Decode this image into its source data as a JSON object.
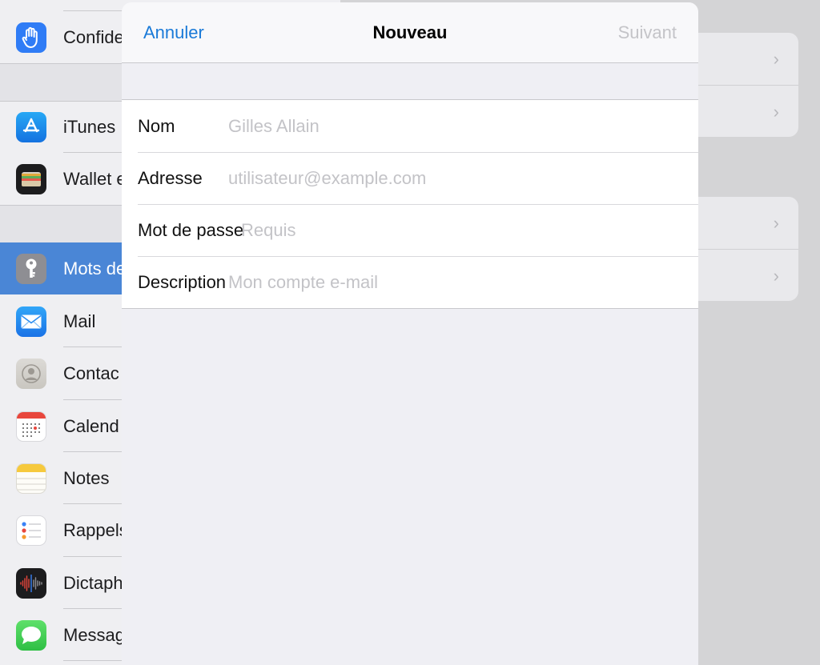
{
  "sidebar": {
    "items": [
      {
        "label": "Confide",
        "icon": "hand-icon"
      },
      {
        "label": "iTunes",
        "icon": "app-store-icon"
      },
      {
        "label": "Wallet e",
        "icon": "wallet-icon"
      },
      {
        "label": "Mots de",
        "icon": "key-icon",
        "selected": true
      },
      {
        "label": "Mail",
        "icon": "mail-icon"
      },
      {
        "label": "Contac",
        "icon": "contacts-icon"
      },
      {
        "label": "Calend",
        "icon": "calendar-icon"
      },
      {
        "label": "Notes",
        "icon": "notes-icon"
      },
      {
        "label": "Rappels",
        "icon": "reminders-icon"
      },
      {
        "label": "Dictaph",
        "icon": "voice-memos-icon"
      },
      {
        "label": "Messag",
        "icon": "messages-icon"
      }
    ]
  },
  "modal": {
    "cancel_label": "Annuler",
    "title": "Nouveau",
    "next_label": "Suivant",
    "fields": [
      {
        "label": "Nom",
        "placeholder": "Gilles Allain",
        "value": ""
      },
      {
        "label": "Adresse",
        "placeholder": "utilisateur@example.com",
        "value": ""
      },
      {
        "label": "Mot de passe",
        "placeholder": "Requis",
        "value": ""
      },
      {
        "label": "Description",
        "placeholder": "Mon compte e-mail",
        "value": ""
      }
    ]
  },
  "colors": {
    "accent": "#1a7ad8",
    "disabled": "#c4c4c8",
    "selected_row": "#4a86d6"
  }
}
